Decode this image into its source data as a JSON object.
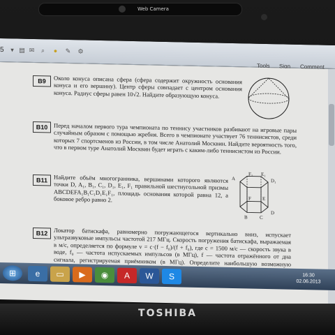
{
  "camera": {
    "label": "Web Camera"
  },
  "laptop": {
    "brand": "TOSHIBA"
  },
  "toolbar": {
    "page_number": "5",
    "menu": [
      "Tools",
      "Sign",
      "Comment"
    ]
  },
  "tasks": [
    {
      "id": "B9",
      "text": "Около конуса описана сфера (сфера содержит окружность основания конуса и его вершину). Центр сферы совпадает с центром основания конуса. Радиус сферы равен 10√2. Найдите образующую конуса."
    },
    {
      "id": "B10",
      "text": "Перед началом первого тура чемпионата по теннису участников разбивают на игровые пары случайным образом с помощью жребия. Всего в чемпионате участвует 76 теннисистов, среди которых 7 спортсменов из России, в том числе Анатолий Москвин. Найдите вероятность того, что в первом туре Анатолий Москвин будет играть с каким-либо теннисистом из России."
    },
    {
      "id": "B11",
      "text": "Найдите объём многогранника, вершинами которого являются точки D, A₁, B₁, C₁, D₁, E₁, F₁ правильной шестиугольной призмы ABCDEFA₁B₁C₁D₁E₁F₁, площадь основания которой равна 12, а боковое ребро равно 2."
    },
    {
      "id": "B12",
      "text": "Локатор батискафа, равномерно погружающегося вертикально вниз, испускает ультразвуковые импульсы частотой 217 МГц. Скорость погружения батискафа, выражаемая в м/с, определяется по формуле v = c·(f − f₀)/(f + f₀), где c = 1500 м/с — скорость звука в воде, f₀ — частота испускаемых импульсов (в МГц), f — частота отражённого от дна сигнала, регистрируемая приёмником (в МГц). Определите наибольшую возможную частоту отражённого сигнала f, если скорость погружения батискафа не"
    }
  ],
  "prism_labels": [
    "A",
    "F₁",
    "E₁",
    "D₁",
    "F",
    "E",
    "B",
    "C",
    "D"
  ],
  "taskbar": {
    "apps": [
      "start-orb-icon",
      "ie-icon",
      "folder-icon",
      "media-icon",
      "chrome-icon",
      "pdf-icon",
      "word-icon",
      "skype-icon"
    ],
    "time": "16:30",
    "date": "02.06.2013"
  }
}
